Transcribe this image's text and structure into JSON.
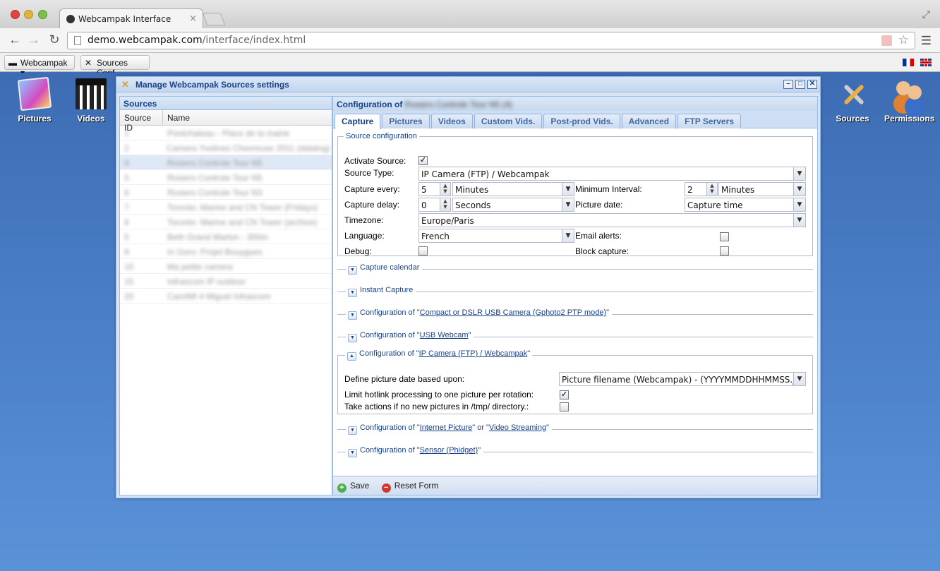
{
  "browser": {
    "tab_title": "Webcampak Interface",
    "url_host": "demo.webcampak.com",
    "url_path": "/interface/index.html",
    "tab_close": "×"
  },
  "bookmarks": {
    "webcampak": "Webcampak ▾",
    "sources_conf": "Sources Conf."
  },
  "desktop": {
    "icons": [
      "Pictures",
      "Videos",
      "Sources",
      "Permissions"
    ]
  },
  "window": {
    "title": "Manage Webcampak Sources settings",
    "sources_panel": {
      "header": "Sources",
      "col_id": "Source ID",
      "col_name": "Name",
      "rows": [
        {
          "id": "1",
          "name": "Pontchateau - Place de la mairie"
        },
        {
          "id": "2",
          "name": "Camera Yvelines Chevreuse 2011 (datalog)"
        },
        {
          "id": "4",
          "name": "Rosiers Controle Tour N5"
        },
        {
          "id": "5",
          "name": "Rosiers Controle Tour N5"
        },
        {
          "id": "6",
          "name": "Rosiers Controle Tour N3"
        },
        {
          "id": "7",
          "name": "Toronto: Marine and CN Tower (Fridays)"
        },
        {
          "id": "8",
          "name": "Toronto: Marine and CN Tower (archive)"
        },
        {
          "id": "5",
          "name": "Beth Grand Marton - 300m"
        },
        {
          "id": "9",
          "name": "In Goro: Projet Bouygues"
        },
        {
          "id": "10",
          "name": "Ma petite camera"
        },
        {
          "id": "15",
          "name": "Infrascom IP outdoor"
        },
        {
          "id": "20",
          "name": "CamIMI 4 Miguel Infrascom"
        }
      ]
    },
    "config": {
      "header_prefix": "Configuration of",
      "header_source": "Rosiers Controle Tour N5 (4)",
      "tabs": [
        "Capture",
        "Pictures",
        "Videos",
        "Custom Vids.",
        "Post-prod Vids.",
        "Advanced",
        "FTP Servers"
      ],
      "source_config_legend": "Source configuration",
      "activate_source_label": "Activate Source:",
      "source_type_label": "Source Type:",
      "source_type_value": "IP Camera (FTP) / Webcampak",
      "capture_every_label": "Capture every:",
      "capture_every_value": "5",
      "capture_every_unit": "Minutes",
      "min_interval_label": "Minimum Interval:",
      "min_interval_value": "2",
      "min_interval_unit": "Minutes",
      "capture_delay_label": "Capture delay:",
      "capture_delay_value": "0",
      "capture_delay_unit": "Seconds",
      "picture_date_label": "Picture date:",
      "picture_date_value": "Capture time",
      "timezone_label": "Timezone:",
      "timezone_value": "Europe/Paris",
      "language_label": "Language:",
      "language_value": "French",
      "email_alerts_label": "Email alerts:",
      "debug_label": "Debug:",
      "block_capture_label": "Block capture:",
      "sections": {
        "capture_calendar": "Capture calendar",
        "instant_capture": "Instant Capture",
        "config_of": "Configuration of",
        "gphoto": "Compact or DSLR USB Camera (Gphoto2 PTP mode)",
        "usb_webcam": "USB Webcam",
        "ipcam": "IP Camera (FTP) / Webcampak",
        "internet_picture": "Internet Picture",
        "or": "or",
        "video_streaming": "Video Streaming",
        "sensor": "Sensor (Phidget)"
      },
      "ipcam_fields": {
        "define_date_label": "Define picture date based upon:",
        "define_date_value": "Picture filename (Webcampak) - (YYYYMMDDHHMMSS.jpg)",
        "limit_hotlink_label": "Limit hotlink processing to one picture per rotation:",
        "take_actions_label": "Take actions if no new pictures in /tmp/ directory.:"
      }
    },
    "footer": {
      "save": "Save",
      "reset": "Reset Form"
    }
  }
}
